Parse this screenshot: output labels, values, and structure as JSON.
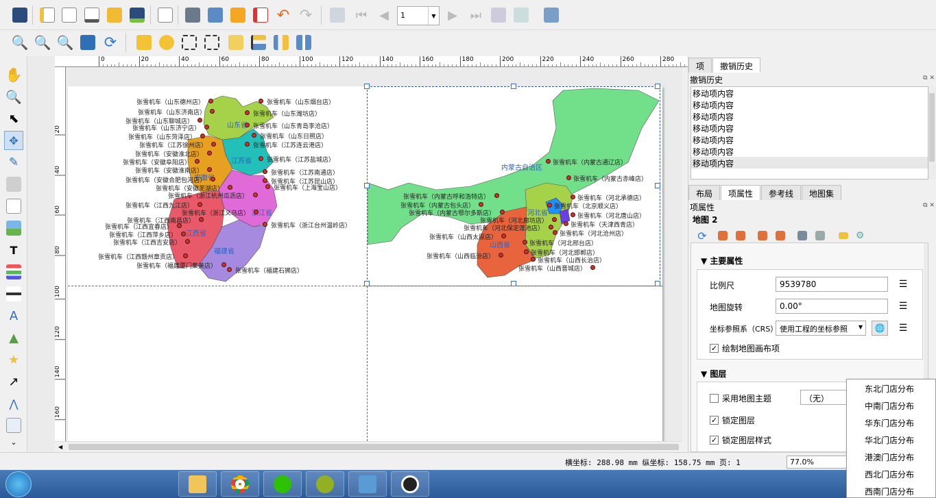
{
  "toolbar1": {
    "page_value": "1",
    "icons": [
      "save-icon",
      "new-layout-icon",
      "duplicate-layout-icon",
      "layout-manager-icon",
      "open-template-icon",
      "save-template-icon",
      "page-setup-icon",
      "print-icon",
      "export-image-icon",
      "export-svg-icon",
      "export-pdf-icon",
      "undo-icon",
      "redo-icon",
      "atlas-preview-icon",
      "first-feature-icon",
      "prev-feature-icon",
      "next-feature-icon",
      "last-feature-icon",
      "print-atlas-icon",
      "export-atlas-icon",
      "atlas-settings-icon"
    ]
  },
  "toolbar2": {
    "icons": [
      "zoom-in-icon",
      "zoom-out-icon",
      "zoom-100-icon",
      "zoom-full-icon",
      "refresh-icon",
      "lock-icon",
      "unlock-icon",
      "group-icon",
      "ungroup-icon",
      "raise-icon",
      "align-icon",
      "distribute-icon",
      "resize-icon"
    ]
  },
  "left_tools": [
    "pan-icon",
    "zoom-tool-icon",
    "select-icon",
    "move-content-icon",
    "edit-nodes-icon",
    "add-3d-icon",
    "add-map-icon",
    "add-picture-icon",
    "add-label-icon",
    "add-legend-icon",
    "add-scalebar-icon",
    "add-north-arrow-icon",
    "add-shape-icon",
    "add-marker-icon",
    "add-arrow-icon",
    "add-node-icon",
    "add-html-icon",
    "more-tools-icon"
  ],
  "ruler": {
    "h_ticks": [
      "0",
      "20",
      "40",
      "60",
      "80",
      "100",
      "120",
      "140",
      "160",
      "180",
      "200",
      "220",
      "240",
      "260",
      "280",
      "300"
    ],
    "v_ticks": [
      "20",
      "40",
      "60",
      "80",
      "100",
      "120",
      "140",
      "160",
      "180",
      "200"
    ]
  },
  "map_left": {
    "provinces": [
      "山东省",
      "江苏省",
      "浙江省",
      "安徽省",
      "江西省",
      "福建省"
    ],
    "labels": [
      "张雪机车（山东德州店）",
      "张雪机车（山东烟台店）",
      "张雪机车（山东济南店）",
      "张雪机车（山东潍坊店）",
      "张雪机车（山东聊城店）",
      "张雪机车（山东济宁店）",
      "张雪机车（山东青岛李沧店）",
      "张雪机车（山东菏泽店）",
      "张雪机车（山东日照店）",
      "张雪机车（江苏徐州店）",
      "张雪机车（江苏连云港店）",
      "张雪机车（安徽淮北店）",
      "张雪机车（安徽阜阳店）",
      "张雪机车（江苏盐城店）",
      "张雪机车（安徽淮南店）",
      "张雪机车（江苏南通店）",
      "张雪机车（安徽合肥包河店）",
      "张雪机车（江苏昆山店）",
      "张雪机车（安徽芜湖店）",
      "张雪机车（上海宝山店）",
      "张雪机车（浙江杭州瓜沥店）",
      "张雪机车（江西九江店）",
      "张雪机车（浙江义乌店）",
      "张雪机车（江西南昌店）",
      "张雪机车（江西宜春店）",
      "张雪机车（浙江台州温岭店）",
      "张雪机车（江西萍乡店）",
      "张雪机车（江西吉安店）",
      "张雪机车（江西赣州章贡店）",
      "张雪机车（福建厦门集美店）",
      "张雪机车（福建石狮店）"
    ]
  },
  "map_right": {
    "provinces": [
      "内蒙古自治区",
      "河北省",
      "山西省"
    ],
    "labels": [
      "张雪机车（内蒙古通辽店）",
      "张雪机车（内蒙古赤峰店）",
      "张雪机车（内蒙古呼和浩特店）",
      "张雪机车（内蒙古包头店）",
      "张雪机车（内蒙古鄂尔多斯店）",
      "张雪机车（河北承德店）",
      "张雪机车（北京顺义店）",
      "张雪机车（河北唐山店）",
      "张雪机车（河北廊坊店）",
      "张雪机车（天津西青店）",
      "张雪机车（河北保定莲池店）",
      "张雪机车（河北沧州店）",
      "张雪机车（山西太原店）",
      "张雪机车（河北邢台店）",
      "张雪机车（河北邯郸店）",
      "张雪机车（山西临汾店）",
      "张雪机车（山西长治店）",
      "张雪机车（山西晋城店）"
    ]
  },
  "right_panel": {
    "top_tabs": [
      "项",
      "撤销历史"
    ],
    "history_title": "撤销历史",
    "history_items": [
      "移动项内容",
      "移动项内容",
      "移动项内容",
      "移动项内容",
      "移动项内容",
      "移动项内容",
      "移动项内容"
    ],
    "mid_tabs": [
      "布局",
      "项属性",
      "参考线",
      "地图集"
    ],
    "props_title": "项属性",
    "map_name": "地图 2",
    "main_props": {
      "section": "主要属性",
      "scale_label": "比例尺",
      "scale_value": "9539780",
      "rotation_label": "地图旋转",
      "rotation_value": "0.00°",
      "crs_label": "坐标参照系（CRS）",
      "crs_value": "使用工程的坐标参照",
      "draw_canvas_items": "绘制地图画布项"
    },
    "layers": {
      "section": "图层",
      "use_theme": "采用地图主题",
      "theme_value": "（无）",
      "lock_layers": "锁定图层",
      "lock_styles": "锁定图层样式"
    }
  },
  "theme_dropdown": [
    "东北门店分布",
    "中南门店分布",
    "华东门店分布",
    "华北门店分布",
    "港澳门店分布",
    "西北门店分布",
    "西南门店分布"
  ],
  "status": {
    "coords": "横坐标: 288.98 mm 纵坐标: 158.75 mm 页: 1",
    "zoom": "77.0%"
  },
  "taskbar": {
    "apps": [
      "file-explorer-icon",
      "chrome-icon",
      "wechat-icon",
      "qgis-icon",
      "image-viewer-icon",
      "qq-icon"
    ]
  }
}
